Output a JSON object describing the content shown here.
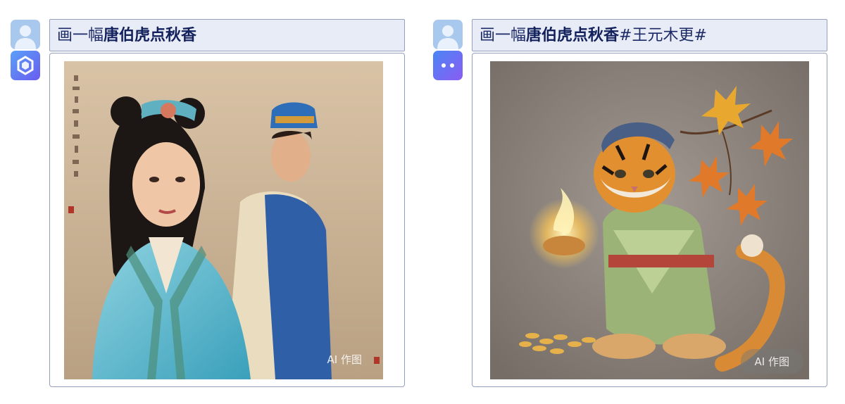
{
  "panels": [
    {
      "prompt_prefix": "画一幅",
      "prompt_bold": "唐伯虎点秋香",
      "prompt_suffix": "",
      "watermark": "AI 作图",
      "bot_avatar": "hexagon-logo-icon"
    },
    {
      "prompt_prefix": "画一幅",
      "prompt_bold": "唐伯虎点秋香",
      "prompt_suffix": "#王元木更#",
      "watermark": "AI 作图",
      "bot_avatar": "robot-face-icon"
    }
  ],
  "colors": {
    "prompt_bg": "#e8ecf6",
    "border": "#95a0bf",
    "prompt_text": "#1b2a66",
    "user_avatar": "#a9c8ee",
    "bot_avatar_left": "#5d78f0",
    "bot_avatar_right": "#6e6ff2"
  }
}
